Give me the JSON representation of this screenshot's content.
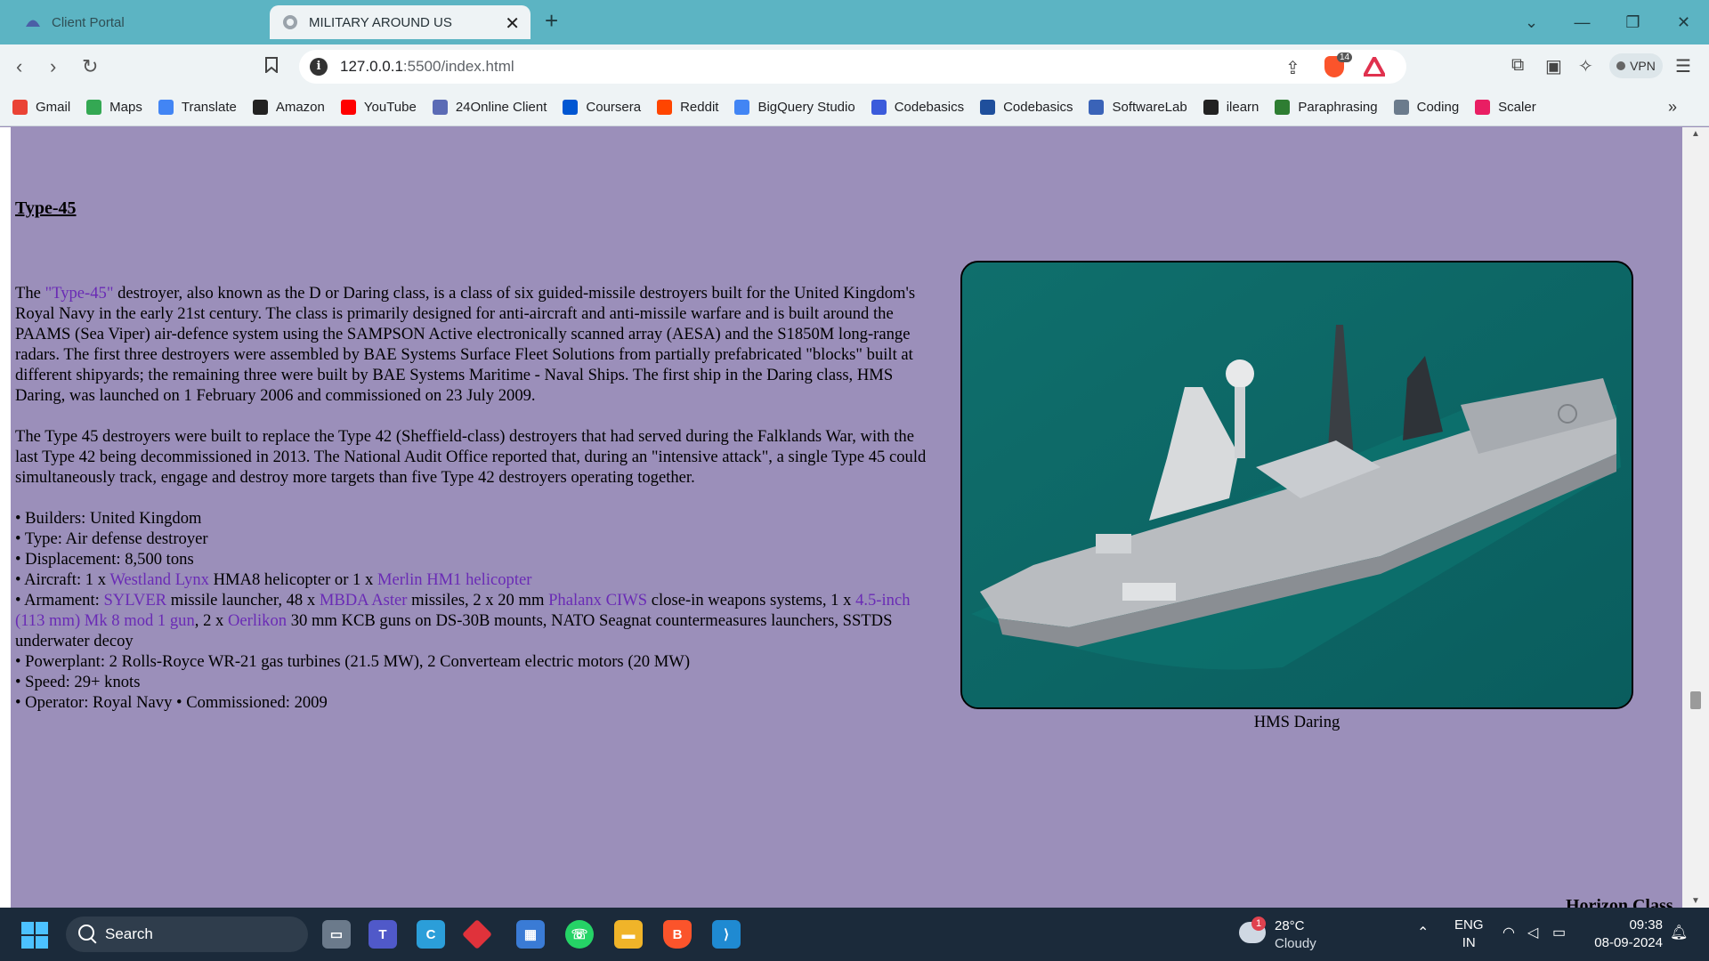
{
  "browser": {
    "tabs": [
      {
        "title": "Client Portal",
        "active": false
      },
      {
        "title": "MILITARY AROUND US",
        "active": true
      }
    ],
    "url_host": "127.0.0.1",
    "url_rest": ":5500/index.html",
    "brave_badge": "14",
    "vpn_label": "VPN",
    "bookmarks": [
      {
        "label": "Gmail",
        "icon": "gmail-icon",
        "color": "#ea4335"
      },
      {
        "label": "Maps",
        "icon": "maps-icon",
        "color": "#34a853"
      },
      {
        "label": "Translate",
        "icon": "translate-icon",
        "color": "#4285f4"
      },
      {
        "label": "Amazon",
        "icon": "amazon-icon",
        "color": "#222222"
      },
      {
        "label": "YouTube",
        "icon": "youtube-icon",
        "color": "#ff0000"
      },
      {
        "label": "24Online Client",
        "icon": "online-client-icon",
        "color": "#5b6bb5"
      },
      {
        "label": "Coursera",
        "icon": "coursera-icon",
        "color": "#0056d2"
      },
      {
        "label": "Reddit",
        "icon": "reddit-icon",
        "color": "#ff4500"
      },
      {
        "label": "BigQuery Studio",
        "icon": "bigquery-icon",
        "color": "#4285f4"
      },
      {
        "label": "Codebasics",
        "icon": "codebasics-rocket-icon",
        "color": "#3b5bdb"
      },
      {
        "label": "Codebasics",
        "icon": "codebasics-icon",
        "color": "#1f4f9c"
      },
      {
        "label": "SoftwareLab",
        "icon": "softwarelab-icon",
        "color": "#3a63b8"
      },
      {
        "label": "ilearn",
        "icon": "ilearn-icon",
        "color": "#222222"
      },
      {
        "label": "Paraphrasing",
        "icon": "paraphrasing-icon",
        "color": "#2e7d32"
      },
      {
        "label": "Coding",
        "icon": "coding-icon",
        "color": "#6b7b8c"
      },
      {
        "label": "Scaler",
        "icon": "scaler-icon",
        "color": "#e91e63"
      }
    ]
  },
  "page": {
    "heading": "Type-45",
    "para1": {
      "before": "The ",
      "link": "\"Type-45\"",
      "after": " destroyer, also known as the D or Daring class, is a class of six guided-missile destroyers built for the United Kingdom's Royal Navy in the early 21st century. The class is primarily designed for anti-aircraft and anti-missile warfare and is built around the PAAMS (Sea Viper) air-defence system using the SAMPSON Active electronically scanned array (AESA) and the S1850M long-range radars. The first three destroyers were assembled by BAE Systems Surface Fleet Solutions from partially prefabricated \"blocks\" built at different shipyards; the remaining three were built by BAE Systems Maritime - Naval Ships. The first ship in the Daring class, HMS Daring, was launched on 1 February 2006 and commissioned on 23 July 2009."
    },
    "para2": "The Type 45 destroyers were built to replace the Type 42 (Sheffield-class) destroyers that had served during the Falklands War, with the last Type 42 being decommissioned in 2013. The National Audit Office reported that, during an \"intensive attack\", a single Type 45 could simultaneously track, engage and destroy more targets than five Type 42 destroyers operating together.",
    "specs": {
      "builders": "• Builders: United Kingdom",
      "type": "• Type: Air defense destroyer",
      "displacement": "• Displacement: 8,500 tons",
      "aircraft_pre": "• Aircraft: 1 x ",
      "aircraft_link1": "Westland Lynx",
      "aircraft_mid": " HMA8 helicopter or 1 x ",
      "aircraft_link2": "Merlin HM1 helicopter",
      "arm_pre": "• Armament: ",
      "arm_link1": "SYLVER",
      "arm_t1": " missile launcher, 48 x ",
      "arm_link2": "MBDA Aster",
      "arm_t2": " missiles, 2 x 20 mm ",
      "arm_link3": "Phalanx CIWS",
      "arm_t3": " close-in weapons systems, 1 x ",
      "arm_link4": "4.5-inch (113 mm) Mk 8 mod 1 gun",
      "arm_t4": ", 2 x ",
      "arm_link5": "Oerlikon",
      "arm_t5": " 30 mm KCB guns on DS-30B mounts, NATO Seagnat countermeasures launchers, SSTDS underwater decoy",
      "powerplant": "• Powerplant: 2 Rolls-Royce WR-21 gas turbines (21.5 MW), 2 Converteam electric motors (20 MW)",
      "speed": "• Speed: 29+ knots",
      "operator": "• Operator: Royal Navy • Commissioned: 2009"
    },
    "image_caption": "HMS Daring",
    "next_heading": "Horizon Class"
  },
  "taskbar": {
    "search_label": "Search",
    "weather_temp": "28°C",
    "weather_desc": "Cloudy",
    "weather_badge": "1",
    "lang1": "ENG",
    "lang2": "IN",
    "time": "09:38",
    "date": "08-09-2024"
  }
}
